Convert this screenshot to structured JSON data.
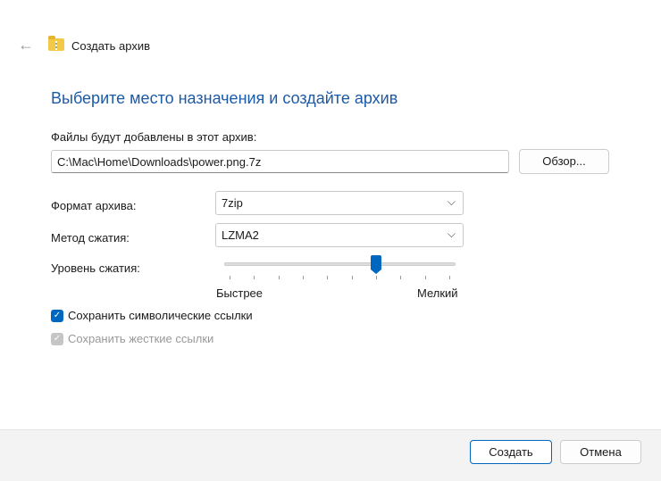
{
  "header": {
    "back_icon": "arrow-left-icon",
    "title": "Создать архив"
  },
  "heading": "Выберите место назначения и создайте архив",
  "path": {
    "label": "Файлы будут добавлены в этот архив:",
    "value": "C:\\Mac\\Home\\Downloads\\power.png.7z",
    "browse": "Обзор..."
  },
  "format": {
    "label": "Формат архива:",
    "value": "7zip"
  },
  "method": {
    "label": "Метод сжатия:",
    "value": "LZMA2"
  },
  "level": {
    "label": "Уровень сжатия:",
    "min_label": "Быстрее",
    "max_label": "Мелкий",
    "value": 6,
    "max": 9
  },
  "checkboxes": [
    {
      "label": "Сохранить символические ссылки",
      "checked": true,
      "enabled": true
    },
    {
      "label": "Сохранить жесткие ссылки",
      "checked": true,
      "enabled": false
    }
  ],
  "footer": {
    "create": "Создать",
    "cancel": "Отмена"
  },
  "colors": {
    "accent": "#0067c0",
    "heading": "#1c5aa6"
  }
}
